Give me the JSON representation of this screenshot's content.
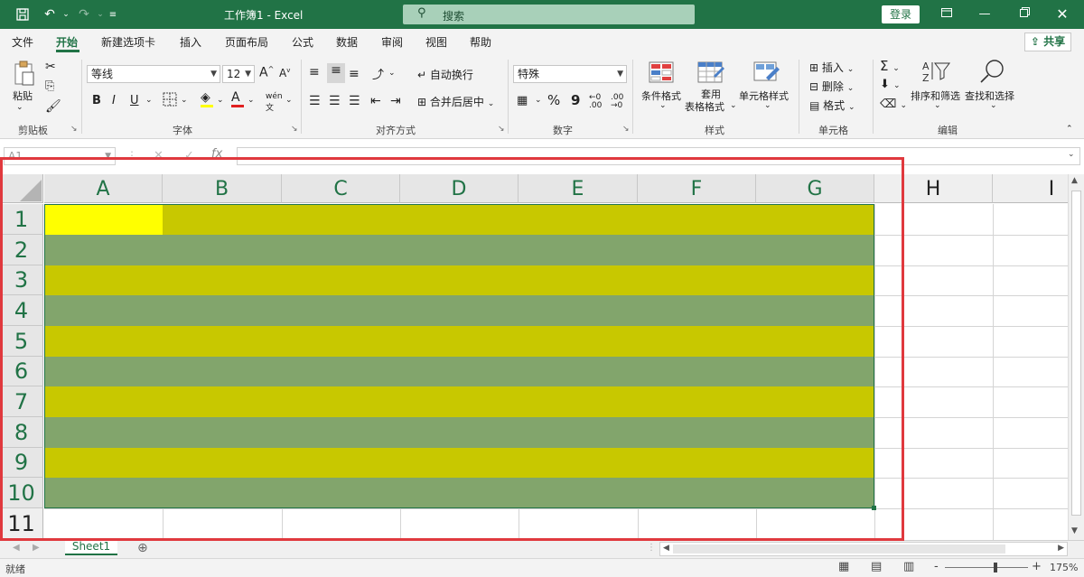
{
  "titlebar": {
    "doc_title": "工作簿1 - Excel",
    "search_placeholder": "搜索",
    "login_label": "登录",
    "save_icon": "save-icon",
    "undo_icon": "undo-icon",
    "redo_icon": "redo-icon"
  },
  "menu": {
    "items": [
      "文件",
      "开始",
      "新建选项卡",
      "插入",
      "页面布局",
      "公式",
      "数据",
      "审阅",
      "视图",
      "帮助"
    ],
    "active": "开始",
    "share_label": "共享"
  },
  "ribbon": {
    "clipboard": {
      "paste_label": "粘贴",
      "group_label": "剪贴板"
    },
    "font": {
      "font_name": "等线",
      "font_size": "12",
      "group_label": "字体",
      "bold": "B",
      "italic": "I",
      "underline": "U"
    },
    "alignment": {
      "wrap_label": "自动换行",
      "merge_label": "合并后居中",
      "group_label": "对齐方式"
    },
    "number": {
      "format": "特殊",
      "percent": "%",
      "comma": "9",
      "group_label": "数字"
    },
    "styles": {
      "conditional_label": "条件格式",
      "table_label_1": "套用",
      "table_label_2": "表格格式",
      "cell_styles_label": "单元格样式",
      "group_label": "样式"
    },
    "cells": {
      "insert_label": "插入",
      "delete_label": "删除",
      "format_label": "格式",
      "group_label": "单元格"
    },
    "editing": {
      "sort_label": "排序和筛选",
      "find_label": "查找和选择",
      "group_label": "编辑"
    }
  },
  "formula_bar": {
    "name_box": "A1",
    "fx": "fx",
    "content": ""
  },
  "grid": {
    "columns": [
      "A",
      "B",
      "C",
      "D",
      "E",
      "F",
      "G",
      "H",
      "I"
    ],
    "selected_columns": [
      "A",
      "B",
      "C",
      "D",
      "E",
      "F",
      "G"
    ],
    "rows": [
      "1",
      "2",
      "3",
      "4",
      "5",
      "6",
      "7",
      "8",
      "9",
      "10",
      "11"
    ],
    "selected_rows": [
      "1",
      "2",
      "3",
      "4",
      "5",
      "6",
      "7",
      "8",
      "9",
      "10"
    ],
    "active_cell": "A1",
    "colors": {
      "active_cell_fill": "#ffff00",
      "odd_row_fill": "#c8c800",
      "even_row_fill": "#82a56c",
      "highlight_border": "#e0393e"
    }
  },
  "sheets": {
    "tabs": [
      "Sheet1"
    ],
    "add_icon": "plus-circle-icon"
  },
  "status": {
    "ready": "就绪",
    "zoom": "175%",
    "zoom_minus": "-",
    "zoom_plus": "+"
  }
}
